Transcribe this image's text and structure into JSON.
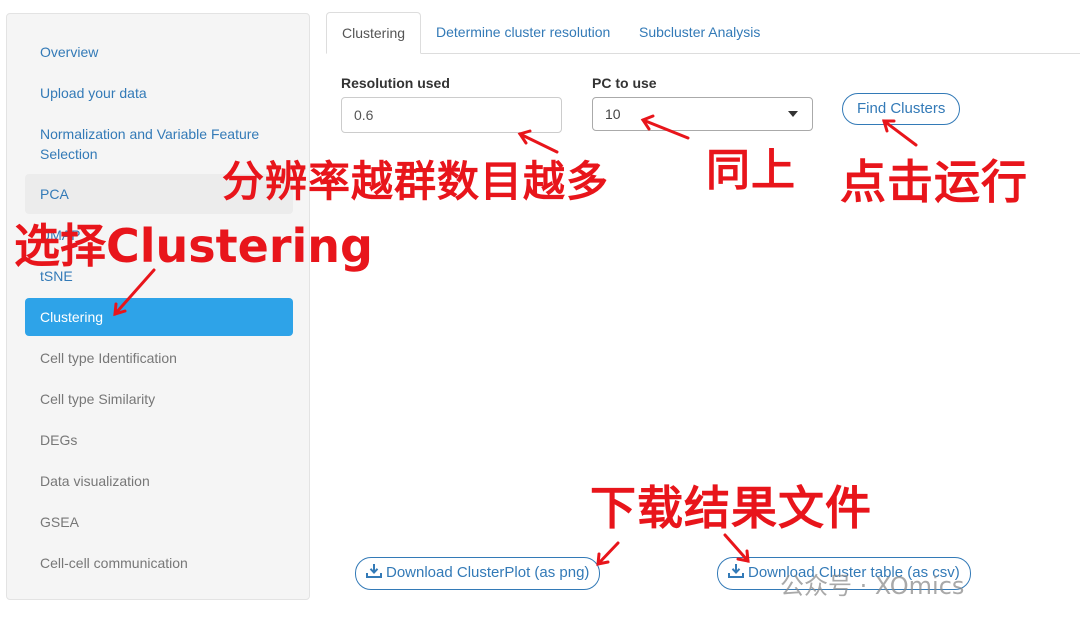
{
  "sidebar": {
    "items": [
      {
        "label": "Overview",
        "state": "link"
      },
      {
        "label": "Upload your data",
        "state": "link"
      },
      {
        "label": "Normalization and Variable Feature Selection",
        "state": "link"
      },
      {
        "label": "PCA",
        "state": "link"
      },
      {
        "label": "UMAP",
        "state": "link"
      },
      {
        "label": "tSNE",
        "state": "link"
      },
      {
        "label": "Clustering",
        "state": "active"
      },
      {
        "label": "Cell type Identification",
        "state": "disabled"
      },
      {
        "label": "Cell type Similarity",
        "state": "disabled"
      },
      {
        "label": "DEGs",
        "state": "disabled"
      },
      {
        "label": "Data visualization",
        "state": "disabled"
      },
      {
        "label": "GSEA",
        "state": "disabled"
      },
      {
        "label": "Cell-cell communication",
        "state": "disabled"
      }
    ]
  },
  "tabs": [
    {
      "label": "Clustering",
      "active": true
    },
    {
      "label": "Determine cluster resolution",
      "active": false
    },
    {
      "label": "Subcluster Analysis",
      "active": false
    }
  ],
  "form": {
    "resolution_label": "Resolution used",
    "resolution_value": "0.6",
    "pc_label": "PC to use",
    "pc_value": "10",
    "find_clusters_label": "Find Clusters"
  },
  "downloads": {
    "plot_label": "Download ClusterPlot (as png)",
    "table_label": "Download Cluster table (as csv)"
  },
  "annotations": {
    "resolution_note": "分辨率越群数目越多",
    "same_note": "同上",
    "run_note": "点击运行",
    "select_note": "选择Clustering",
    "download_note": "下载结果文件"
  },
  "watermark": "公众号 · XOmics",
  "colors": {
    "link": "#337ab7",
    "active_nav": "#2ea3e8",
    "annotation": "#e8151b",
    "sidebar_bg": "#f5f5f5"
  }
}
